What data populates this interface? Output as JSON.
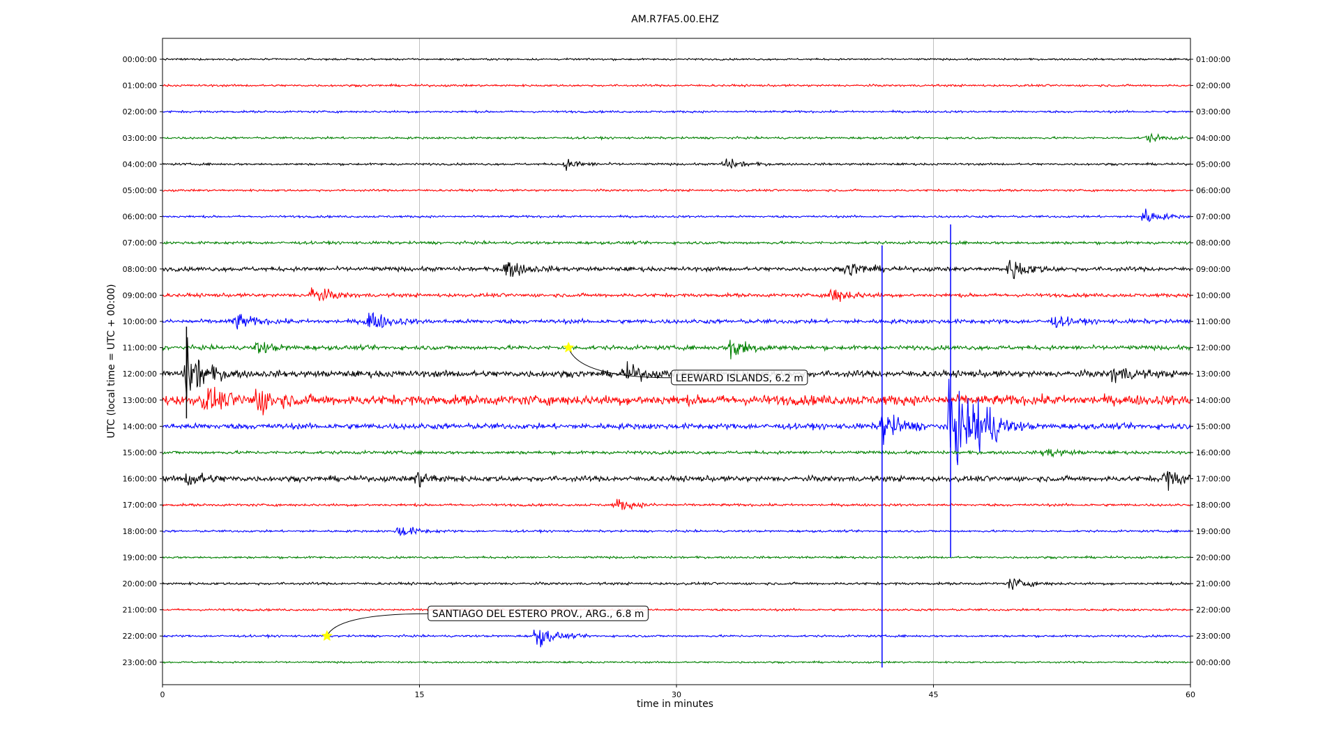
{
  "chart_data": {
    "type": "line",
    "title": "AM.R7FA5.00.EHZ",
    "xlabel": "time in minutes",
    "ylabel": "UTC (local time = UTC + 00:00)",
    "xlim": [
      0,
      60
    ],
    "xticks": [
      0,
      15,
      30,
      45,
      60
    ],
    "grid": "vertical",
    "trace_colors": [
      "#000000",
      "#ff0000",
      "#0000ff",
      "#008000"
    ],
    "left_labels": [
      "00:00:00",
      "01:00:00",
      "02:00:00",
      "03:00:00",
      "04:00:00",
      "05:00:00",
      "06:00:00",
      "07:00:00",
      "08:00:00",
      "09:00:00",
      "10:00:00",
      "11:00:00",
      "12:00:00",
      "13:00:00",
      "14:00:00",
      "15:00:00",
      "16:00:00",
      "17:00:00",
      "18:00:00",
      "19:00:00",
      "20:00:00",
      "21:00:00",
      "22:00:00",
      "23:00:00"
    ],
    "right_labels": [
      "01:00:00",
      "02:00:00",
      "03:00:00",
      "04:00:00",
      "05:00:00",
      "06:00:00",
      "07:00:00",
      "08:00:00",
      "09:00:00",
      "10:00:00",
      "11:00:00",
      "12:00:00",
      "13:00:00",
      "14:00:00",
      "15:00:00",
      "16:00:00",
      "17:00:00",
      "18:00:00",
      "19:00:00",
      "20:00:00",
      "21:00:00",
      "22:00:00",
      "23:00:00",
      "00:00:00"
    ],
    "noise_levels": [
      0.05,
      0.06,
      0.06,
      0.06,
      0.06,
      0.06,
      0.06,
      0.08,
      0.12,
      0.1,
      0.12,
      0.12,
      0.18,
      0.28,
      0.16,
      0.09,
      0.15,
      0.07,
      0.06,
      0.06,
      0.07,
      0.06,
      0.06,
      0.05
    ],
    "events": [
      {
        "row": 3,
        "minute": 57.5,
        "amp": 0.25
      },
      {
        "row": 4,
        "minute": 23.5,
        "amp": 0.3
      },
      {
        "row": 4,
        "minute": 32.8,
        "amp": 0.35
      },
      {
        "row": 6,
        "minute": 57.2,
        "amp": 0.5
      },
      {
        "row": 8,
        "minute": 20.0,
        "amp": 0.6
      },
      {
        "row": 8,
        "minute": 40.0,
        "amp": 0.45
      },
      {
        "row": 8,
        "minute": 49.5,
        "amp": 0.7
      },
      {
        "row": 9,
        "minute": 8.7,
        "amp": 0.55
      },
      {
        "row": 9,
        "minute": 39.0,
        "amp": 0.55
      },
      {
        "row": 10,
        "minute": 4.2,
        "amp": 0.5
      },
      {
        "row": 10,
        "minute": 12.0,
        "amp": 0.7
      },
      {
        "row": 10,
        "minute": 52.0,
        "amp": 0.3
      },
      {
        "row": 11,
        "minute": 5.5,
        "amp": 0.35
      },
      {
        "row": 11,
        "minute": 33.2,
        "amp": 0.8
      },
      {
        "row": 12,
        "minute": 1.4,
        "amp": 1.8
      },
      {
        "row": 12,
        "minute": 27.0,
        "amp": 0.5
      },
      {
        "row": 12,
        "minute": 55.5,
        "amp": 0.5
      },
      {
        "row": 13,
        "minute": 2.5,
        "amp": 0.7
      },
      {
        "row": 13,
        "minute": 5.5,
        "amp": 0.8
      },
      {
        "row": 14,
        "minute": 42.0,
        "amp": 1.0
      },
      {
        "row": 14,
        "minute": 46.0,
        "amp": 3.0
      },
      {
        "row": 14,
        "minute": 47.5,
        "amp": 2.0
      },
      {
        "row": 15,
        "minute": 51.5,
        "amp": 0.3
      },
      {
        "row": 16,
        "minute": 1.5,
        "amp": 0.5
      },
      {
        "row": 16,
        "minute": 14.8,
        "amp": 0.45
      },
      {
        "row": 16,
        "minute": 58.5,
        "amp": 0.6
      },
      {
        "row": 17,
        "minute": 26.5,
        "amp": 0.35
      },
      {
        "row": 18,
        "minute": 13.8,
        "amp": 0.4
      },
      {
        "row": 20,
        "minute": 49.5,
        "amp": 0.35
      },
      {
        "row": 22,
        "minute": 21.8,
        "amp": 0.7
      }
    ],
    "spikes": [
      {
        "row": 8,
        "minute": 42.0,
        "up": 0.9,
        "down": 15.2,
        "color_row": 14
      },
      {
        "row": 8,
        "minute": 46.0,
        "up": 1.7,
        "down": 11.0,
        "color_row": 14
      },
      {
        "row": 11,
        "minute": 1.4,
        "up": 0.8,
        "down": 2.7,
        "color_row": 12
      }
    ],
    "annotations": [
      {
        "text": "LEEWARD ISLANDS, 6.2 m",
        "star_row": 11,
        "star_minute": 23.7,
        "label_row": 12.15,
        "label_minute": 29.7
      },
      {
        "text": "SANTIAGO DEL ESTERO PROV., ARG., 6.8 m",
        "star_row": 22,
        "star_minute": 9.6,
        "label_row": 21.15,
        "label_minute": 15.5
      }
    ],
    "star_color": "#ffff00"
  }
}
